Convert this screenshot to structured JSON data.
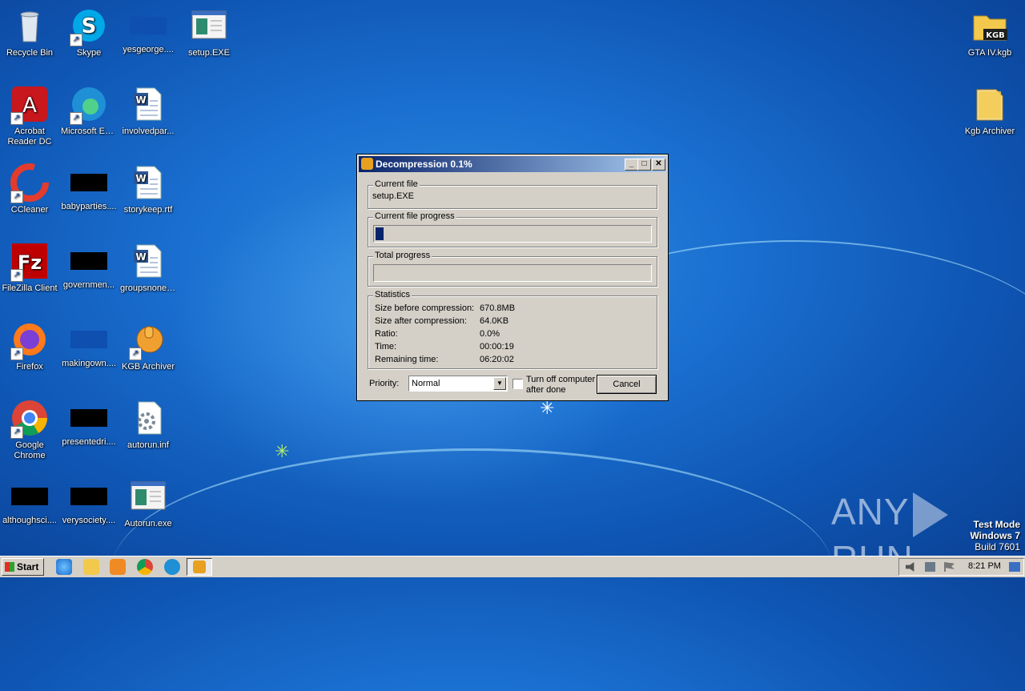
{
  "desktop": {
    "left_icons": [
      {
        "label": "Recycle Bin",
        "icon": "recycle-bin-icon"
      },
      {
        "label": "Skype",
        "icon": "skype-icon"
      },
      {
        "label": "yesgeorge....",
        "icon": "blue-file-icon"
      },
      {
        "label": "setup.EXE",
        "icon": "setup-exe-icon"
      },
      {
        "label": "Acrobat Reader DC",
        "icon": "acrobat-icon"
      },
      {
        "label": "Microsoft Edge",
        "icon": "edge-icon"
      },
      {
        "label": "involvedpar...",
        "icon": "word-doc-icon"
      },
      {
        "label": "CCleaner",
        "icon": "ccleaner-icon"
      },
      {
        "label": "babyparties....",
        "icon": "black-file-icon"
      },
      {
        "label": "storykeep.rtf",
        "icon": "word-doc-icon"
      },
      {
        "label": "FileZilla Client",
        "icon": "filezilla-icon"
      },
      {
        "label": "governmen...",
        "icon": "black-file-icon"
      },
      {
        "label": "groupsnone....",
        "icon": "word-doc-icon"
      },
      {
        "label": "Firefox",
        "icon": "firefox-icon"
      },
      {
        "label": "makingown....",
        "icon": "blue-file-icon"
      },
      {
        "label": "KGB Archiver",
        "icon": "kgb-thumb-icon"
      },
      {
        "label": "Google Chrome",
        "icon": "chrome-icon"
      },
      {
        "label": "presentedri....",
        "icon": "black-file-icon"
      },
      {
        "label": "autorun.inf",
        "icon": "settings-file-icon"
      },
      {
        "label": "althoughsci....",
        "icon": "black-file-icon"
      },
      {
        "label": "verysociety....",
        "icon": "black-file-icon"
      },
      {
        "label": "Autorun.exe",
        "icon": "setup-exe-icon"
      }
    ],
    "right_icons": [
      {
        "label": "GTA IV.kgb",
        "icon": "kgb-folder-icon"
      },
      {
        "label": "Kgb Archiver",
        "icon": "folder-icon"
      }
    ]
  },
  "dialog": {
    "title": "Decompression 0.1%",
    "current_file_label": "Current file",
    "current_file_value": "setup.EXE",
    "current_progress_label": "Current file progress",
    "current_progress_fraction": 0.03,
    "total_progress_label": "Total progress",
    "total_progress_fraction": 0.0,
    "statistics_label": "Statistics",
    "stats": [
      {
        "label": "Size before compression:",
        "value": "670.8MB"
      },
      {
        "label": "Size after compression:",
        "value": "64.0KB"
      },
      {
        "label": "Ratio:",
        "value": "0.0%"
      },
      {
        "label": "Time:",
        "value": "00:00:19"
      },
      {
        "label": "Remaining time:",
        "value": "06:20:02"
      }
    ],
    "priority_label": "Priority:",
    "priority_value": "Normal",
    "turn_off_label_1": "Turn off computer",
    "turn_off_label_2": "after done",
    "cancel_label": "Cancel"
  },
  "watermark": {
    "text_left": "ANY",
    "text_right": "RUN",
    "test_mode": "Test Mode",
    "os": "Windows 7",
    "build": "Build 7601"
  },
  "taskbar": {
    "start_label": "Start",
    "clock": "8:21 PM"
  }
}
